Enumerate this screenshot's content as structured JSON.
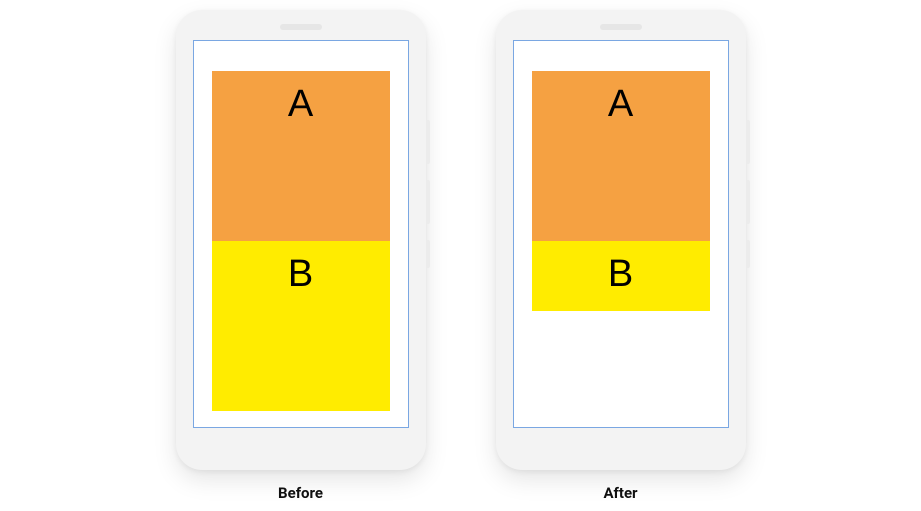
{
  "panels": {
    "before": {
      "caption": "Before",
      "boxA": {
        "label": "A",
        "height": 170,
        "color": "#f5a142"
      },
      "boxB": {
        "label": "B",
        "height": 170,
        "color": "#ffec00"
      }
    },
    "after": {
      "caption": "After",
      "boxA": {
        "label": "A",
        "height": 170,
        "color": "#f5a142"
      },
      "boxB": {
        "label": "B",
        "height": 70,
        "color": "#ffec00"
      }
    }
  }
}
